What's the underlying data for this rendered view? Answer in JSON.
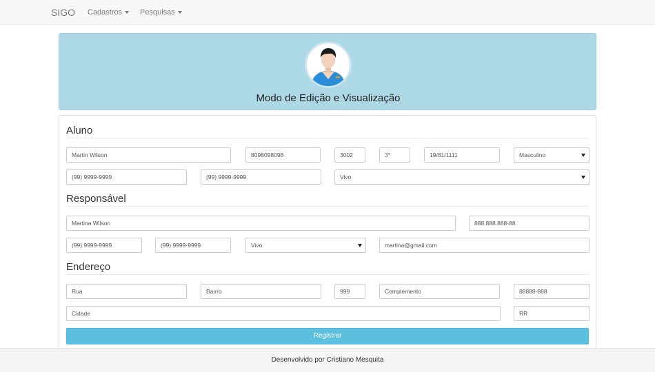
{
  "navbar": {
    "brand": "SIGO",
    "menus": [
      {
        "label": "Cadastros"
      },
      {
        "label": "Pesquisas"
      }
    ]
  },
  "header": {
    "title": "Modo de Edição e Visualização",
    "avatar_icon": "user-avatar-icon"
  },
  "aluno": {
    "section_title": "Aluno",
    "name": "Martin Wilson",
    "registration": "8098098098",
    "number": "3002",
    "grade": "3°",
    "birth_date": "19/81/1111",
    "gender": "Masculino",
    "phone1": "(99) 9999-9999",
    "phone2": "(99) 9999-9999",
    "status": "Vivo"
  },
  "responsavel": {
    "section_title": "Responsável",
    "name": "Martina Wilson",
    "cpf": "888.888.888-88",
    "phone1": "(99) 9999-9999",
    "phone2": "(99) 9999-9999",
    "status": "Vivo",
    "email": "martina@gmail.com"
  },
  "endereco": {
    "section_title": "Endereço",
    "street": "Rua",
    "district": "Bairro",
    "number": "999",
    "complement": "Complemento",
    "zip": "88888-888",
    "city": "Cidade",
    "state": "RR"
  },
  "actions": {
    "submit_label": "Registrar"
  },
  "footer": {
    "text": "Desenvolvido por Cristiano Mesquita"
  },
  "colors": {
    "header_bg": "#add8e6",
    "button_bg": "#5bc0de"
  }
}
